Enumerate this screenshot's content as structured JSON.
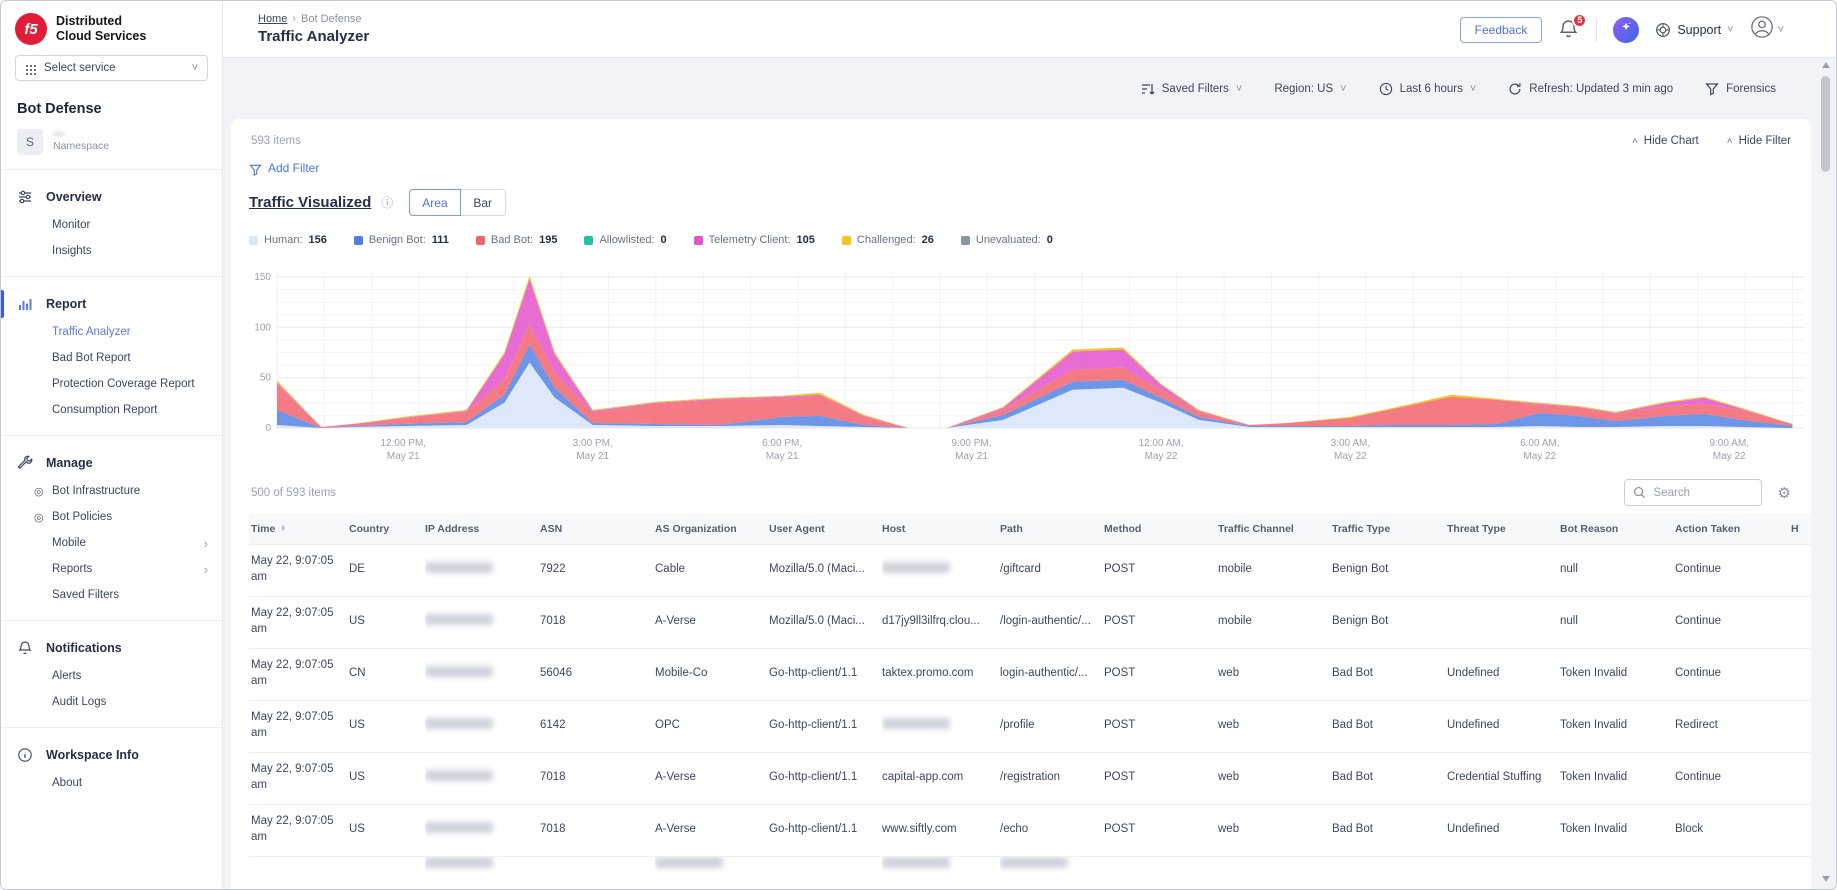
{
  "app": {
    "brand_line1": "Distributed",
    "brand_line2": "Cloud Services",
    "logo_text": "f5",
    "select_service": "Select service",
    "product": "Bot Defense",
    "namespace_initial": "S",
    "namespace_label": "Namespace"
  },
  "breadcrumb": {
    "home": "Home",
    "separator": "›",
    "section": "Bot Defense"
  },
  "page_title": "Traffic Analyzer",
  "header_actions": {
    "feedback": "Feedback",
    "notification_count": "5",
    "support": "Support"
  },
  "toolbar": {
    "items": [
      {
        "icon": "filter-lines-icon",
        "label": "Saved Filters",
        "chevron": true
      },
      {
        "icon": null,
        "label": "Region: US",
        "chevron": true
      },
      {
        "icon": "clock-icon",
        "label": "Last 6 hours",
        "chevron": true
      },
      {
        "icon": "refresh-icon",
        "label": "Refresh: Updated 3 min ago",
        "chevron": false
      },
      {
        "icon": "funnel-icon",
        "label": "Forensics",
        "chevron": false
      }
    ]
  },
  "sidebar": {
    "sections": [
      {
        "label": "Overview",
        "icon": "sliders-icon",
        "active": false,
        "items": [
          {
            "label": "Monitor"
          },
          {
            "label": "Insights"
          }
        ]
      },
      {
        "label": "Report",
        "icon": "bar-chart-icon",
        "active": true,
        "items": [
          {
            "label": "Traffic Analyzer",
            "active": true
          },
          {
            "label": "Bad Bot Report"
          },
          {
            "label": "Protection Coverage Report"
          },
          {
            "label": "Consumption Report"
          }
        ]
      },
      {
        "label": "Manage",
        "icon": "wrench-icon",
        "active": false,
        "items": [
          {
            "label": "Bot Infrastructure",
            "bullet": true
          },
          {
            "label": "Bot Policies",
            "bullet": true
          },
          {
            "label": "Mobile",
            "chevron": true
          },
          {
            "label": "Reports",
            "chevron": true
          },
          {
            "label": "Saved Filters"
          }
        ]
      },
      {
        "label": "Notifications",
        "icon": "bell-icon",
        "active": false,
        "items": [
          {
            "label": "Alerts"
          },
          {
            "label": "Audit Logs"
          }
        ]
      },
      {
        "label": "Workspace Info",
        "icon": "info-icon",
        "active": false,
        "items": [
          {
            "label": "About"
          }
        ]
      }
    ]
  },
  "content": {
    "items_count": "593 items",
    "hide_chart": "Hide Chart",
    "hide_filter": "Hide Filter",
    "add_filter": "Add Filter",
    "chart_title": "Traffic Visualized",
    "chart_modes": [
      "Area",
      "Bar"
    ],
    "chart_mode_active": "Area",
    "table_count": "500 of 593 items",
    "search_placeholder": "Search"
  },
  "chart_data": {
    "type": "area",
    "stacked": true,
    "title": "Traffic Visualized",
    "legend_position": "top",
    "grid": true,
    "y_ticks": [
      0,
      50,
      100,
      150
    ],
    "ylim": [
      0,
      155
    ],
    "xlim": [
      0,
      24.2
    ],
    "x_unit": "hours since 10:00 AM May 21",
    "x_ticks": [
      {
        "t": 2,
        "line1": "12:00 PM,",
        "line2": "May 21"
      },
      {
        "t": 5,
        "line1": "3:00 PM,",
        "line2": "May 21"
      },
      {
        "t": 8,
        "line1": "6:00 PM,",
        "line2": "May 21"
      },
      {
        "t": 11,
        "line1": "9:00 PM,",
        "line2": "May 21"
      },
      {
        "t": 14,
        "line1": "12:00 AM,",
        "line2": "May 22"
      },
      {
        "t": 17,
        "line1": "3:00 AM,",
        "line2": "May 22"
      },
      {
        "t": 20,
        "line1": "6:00 AM,",
        "line2": "May 22"
      },
      {
        "t": 23,
        "line1": "9:00 AM,",
        "line2": "May 22"
      }
    ],
    "legend": [
      {
        "label": "Human",
        "count": 156,
        "color": "#dce7fb"
      },
      {
        "label": "Benign Bot",
        "count": 111,
        "color": "#4e7fe1"
      },
      {
        "label": "Bad Bot",
        "count": 195,
        "color": "#f2636e"
      },
      {
        "label": "Allowlisted",
        "count": 0,
        "color": "#27bfa3"
      },
      {
        "label": "Telemetry Client",
        "count": 105,
        "color": "#e353cd"
      },
      {
        "label": "Challenged",
        "count": 26,
        "color": "#f3c521"
      },
      {
        "label": "Unevaluated",
        "count": 0,
        "color": "#8b93a7"
      }
    ],
    "x": [
      0,
      0.7,
      1.2,
      2,
      3,
      3.6,
      4,
      4.4,
      5,
      6,
      7,
      8,
      8.6,
      9.3,
      10,
      10.6,
      11.5,
      12.6,
      13.4,
      14,
      14.6,
      15.4,
      16,
      17,
      17.6,
      18.6,
      19.3,
      20,
      20.6,
      21.2,
      22,
      22.6,
      23.2,
      24
    ],
    "series": [
      {
        "name": "Human",
        "fill": "#dde8fb",
        "opacity": 1,
        "values": [
          3,
          0,
          1,
          2,
          3,
          25,
          65,
          30,
          3,
          2,
          2,
          3,
          2,
          1,
          0,
          0,
          8,
          38,
          40,
          25,
          8,
          1,
          1,
          1,
          1,
          1,
          1,
          2,
          1,
          1,
          2,
          2,
          1,
          0
        ]
      },
      {
        "name": "Benign Bot",
        "fill": "#4e7fe1",
        "opacity": 0.82,
        "values": [
          15,
          0,
          1,
          2,
          3,
          8,
          18,
          10,
          2,
          2,
          1,
          8,
          10,
          2,
          0,
          0,
          5,
          8,
          8,
          5,
          3,
          1,
          1,
          1,
          2,
          2,
          3,
          13,
          11,
          6,
          10,
          12,
          7,
          2
        ]
      },
      {
        "name": "Bad Bot",
        "fill": "#f2636e",
        "opacity": 0.85,
        "values": [
          25,
          1,
          2,
          5,
          10,
          15,
          20,
          15,
          10,
          20,
          25,
          18,
          20,
          8,
          0,
          0,
          5,
          12,
          12,
          8,
          5,
          1,
          3,
          8,
          15,
          28,
          24,
          8,
          8,
          7,
          10,
          10,
          10,
          2
        ]
      },
      {
        "name": "Allowlisted",
        "fill": "#27bfa3",
        "opacity": 0.85,
        "values": [
          0,
          0,
          0,
          0,
          0,
          0,
          0,
          0,
          0,
          0,
          0,
          0,
          0,
          0,
          0,
          0,
          0,
          0,
          0,
          0,
          0,
          0,
          0,
          0,
          0,
          0,
          0,
          0,
          0,
          0,
          0,
          0,
          0,
          0
        ]
      },
      {
        "name": "Telemetry Client",
        "fill": "#e353cd",
        "opacity": 0.85,
        "values": [
          2,
          0,
          0,
          1,
          1,
          25,
          45,
          18,
          2,
          1,
          1,
          2,
          1,
          1,
          0,
          0,
          2,
          18,
          18,
          5,
          1,
          0,
          0,
          0,
          0,
          0,
          0,
          1,
          1,
          1,
          3,
          6,
          1,
          0
        ]
      },
      {
        "name": "Challenged",
        "fill": "#f3c521",
        "opacity": 1,
        "values": [
          2,
          0,
          0,
          1,
          1,
          2,
          3,
          2,
          1,
          1,
          1,
          1,
          2,
          1,
          0,
          0,
          1,
          2,
          2,
          1,
          1,
          0,
          0,
          1,
          1,
          2,
          1,
          1,
          1,
          1,
          1,
          1,
          1,
          0
        ]
      },
      {
        "name": "Unevaluated",
        "fill": "#8b93a7",
        "opacity": 0.85,
        "values": [
          0,
          0,
          0,
          0,
          0,
          0,
          0,
          0,
          0,
          0,
          0,
          0,
          0,
          0,
          0,
          0,
          0,
          0,
          0,
          0,
          0,
          0,
          0,
          0,
          0,
          0,
          0,
          0,
          0,
          0,
          0,
          0,
          0,
          0
        ]
      }
    ]
  },
  "table": {
    "columns": [
      "Time",
      "Country",
      "IP Address",
      "ASN",
      "AS Organization",
      "User Agent",
      "Host",
      "Path",
      "Method",
      "Traffic Channel",
      "Traffic Type",
      "Threat Type",
      "Bot Reason",
      "Action Taken",
      "H"
    ],
    "rows": [
      {
        "cells": [
          {
            "v": "May 22, 9:07:05 am"
          },
          {
            "v": "DE"
          },
          {
            "redacted": true
          },
          {
            "v": "7922"
          },
          {
            "v": "Cable"
          },
          {
            "v": "Mozilla/5.0 (Maci..."
          },
          {
            "redacted": true
          },
          {
            "v": "/giftcard"
          },
          {
            "v": "POST"
          },
          {
            "v": "mobile"
          },
          {
            "v": "Benign Bot"
          },
          {
            "v": ""
          },
          {
            "v": "null"
          },
          {
            "v": "Continue"
          },
          {
            "v": ""
          }
        ]
      },
      {
        "cells": [
          {
            "v": "May 22, 9:07:05 am"
          },
          {
            "v": "US"
          },
          {
            "redacted": true
          },
          {
            "v": "7018"
          },
          {
            "v": "A-Verse"
          },
          {
            "v": "Mozilla/5.0 (Maci..."
          },
          {
            "v": "d17jy9ll3ilfrq.clou..."
          },
          {
            "v": "/login-authentic/..."
          },
          {
            "v": "POST"
          },
          {
            "v": "mobile"
          },
          {
            "v": "Benign Bot"
          },
          {
            "v": ""
          },
          {
            "v": "null"
          },
          {
            "v": "Continue"
          },
          {
            "v": ""
          }
        ]
      },
      {
        "cells": [
          {
            "v": "May 22, 9:07:05 am"
          },
          {
            "v": "CN"
          },
          {
            "redacted": true
          },
          {
            "v": "56046"
          },
          {
            "v": "Mobile-Co"
          },
          {
            "v": "Go-http-client/1.1"
          },
          {
            "v": "taktex.promo.com"
          },
          {
            "v": "login-authentic/..."
          },
          {
            "v": "POST"
          },
          {
            "v": "web"
          },
          {
            "v": "Bad Bot"
          },
          {
            "v": "Undefined"
          },
          {
            "v": "Token Invalid"
          },
          {
            "v": "Continue"
          },
          {
            "v": ""
          }
        ]
      },
      {
        "cells": [
          {
            "v": "May 22, 9:07:05 am"
          },
          {
            "v": "US"
          },
          {
            "redacted": true
          },
          {
            "v": "6142"
          },
          {
            "v": "OPC"
          },
          {
            "v": "Go-http-client/1.1"
          },
          {
            "redacted": true
          },
          {
            "v": "/profile"
          },
          {
            "v": "POST"
          },
          {
            "v": "web"
          },
          {
            "v": "Bad Bot"
          },
          {
            "v": "Undefined"
          },
          {
            "v": "Token Invalid"
          },
          {
            "v": "Redirect"
          },
          {
            "v": ""
          }
        ]
      },
      {
        "cells": [
          {
            "v": "May 22, 9:07:05 am"
          },
          {
            "v": "US"
          },
          {
            "redacted": true
          },
          {
            "v": "7018"
          },
          {
            "v": "A-Verse"
          },
          {
            "v": "Go-http-client/1.1"
          },
          {
            "v": "capital-app.com"
          },
          {
            "v": "/registration"
          },
          {
            "v": "POST"
          },
          {
            "v": "web"
          },
          {
            "v": "Bad Bot"
          },
          {
            "v": "Credential Stuffing"
          },
          {
            "v": "Token Invalid"
          },
          {
            "v": "Continue"
          },
          {
            "v": ""
          }
        ]
      },
      {
        "cells": [
          {
            "v": "May 22, 9:07:05 am"
          },
          {
            "v": "US"
          },
          {
            "redacted": true
          },
          {
            "v": "7018"
          },
          {
            "v": "A-Verse"
          },
          {
            "v": "Go-http-client/1.1"
          },
          {
            "v": "www.siftly.com"
          },
          {
            "v": "/echo"
          },
          {
            "v": "POST"
          },
          {
            "v": "web"
          },
          {
            "v": "Bad Bot"
          },
          {
            "v": "Undefined"
          },
          {
            "v": "Token Invalid"
          },
          {
            "v": "Block"
          },
          {
            "v": ""
          }
        ]
      }
    ],
    "partial_row": {
      "cells": [
        {
          "v": ""
        },
        {
          "v": ""
        },
        {
          "redacted": true
        },
        {
          "v": ""
        },
        {
          "redacted": true
        },
        {
          "v": ""
        },
        {
          "redacted": true
        },
        {
          "redacted": true
        },
        {
          "v": ""
        },
        {
          "v": ""
        },
        {
          "v": ""
        },
        {
          "v": ""
        },
        {
          "v": ""
        },
        {
          "v": ""
        },
        {
          "v": ""
        }
      ]
    }
  }
}
